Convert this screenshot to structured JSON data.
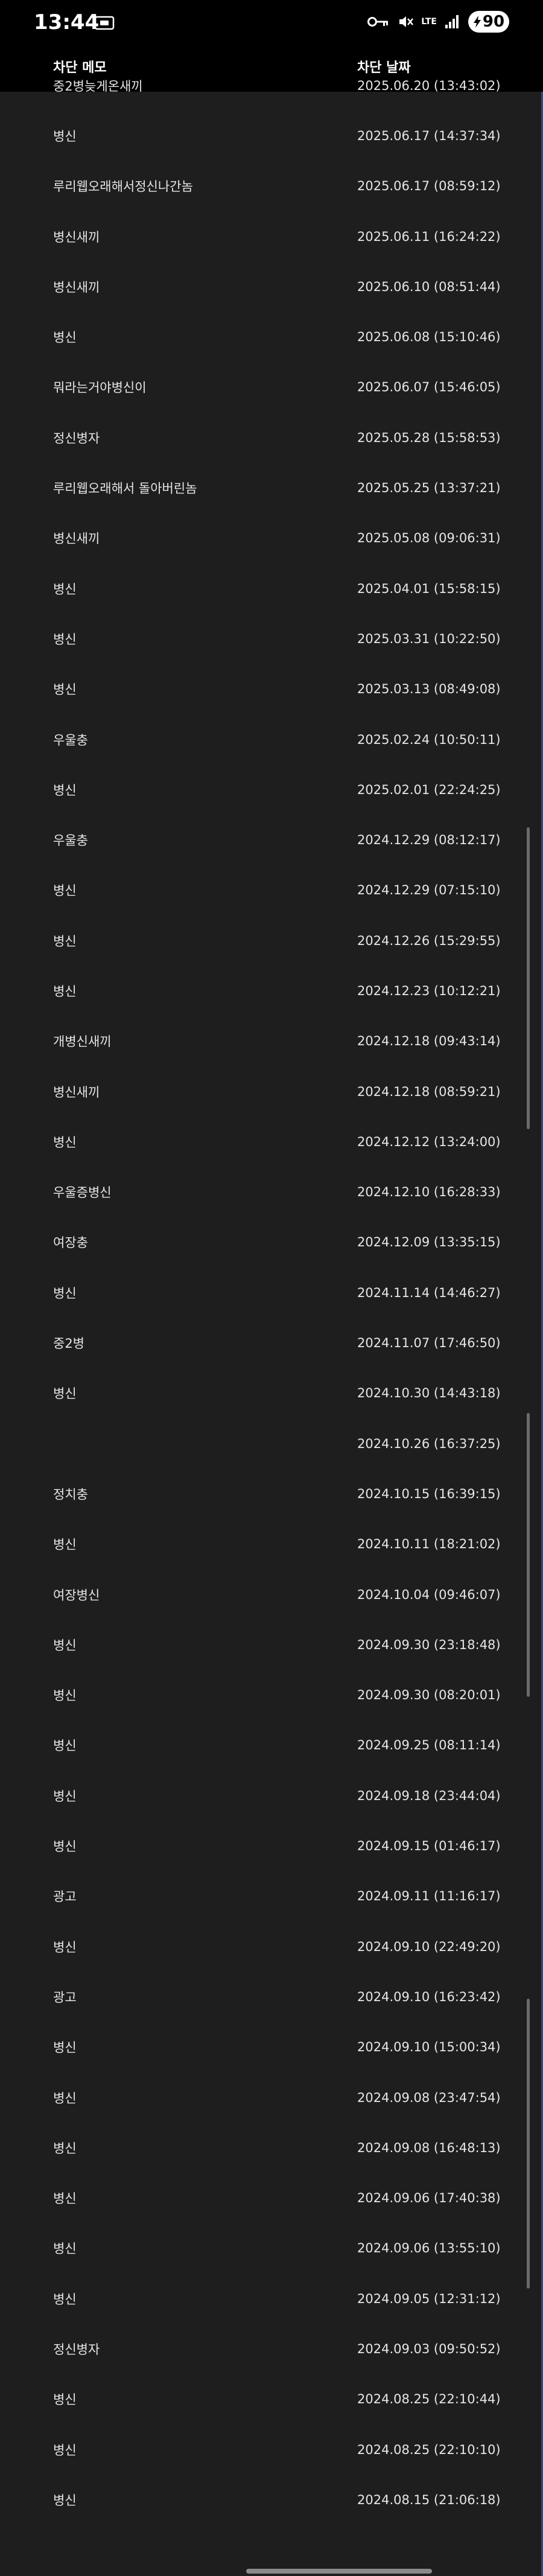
{
  "status_bar": {
    "time": "13:44",
    "network": "LTE",
    "battery": "90"
  },
  "header": {
    "memo_label": "차단 메모",
    "date_label": "차단 날짜"
  },
  "rows": [
    {
      "memo": "중2병늦게온새끼",
      "date": "2025.06.20 (13:43:02)"
    },
    {
      "memo": "병신",
      "date": "2025.06.17 (14:37:34)"
    },
    {
      "memo": "루리웹오래해서정신나간놈",
      "date": "2025.06.17 (08:59:12)"
    },
    {
      "memo": "병신새끼",
      "date": "2025.06.11 (16:24:22)"
    },
    {
      "memo": "병신새끼",
      "date": "2025.06.10 (08:51:44)"
    },
    {
      "memo": "병신",
      "date": "2025.06.08 (15:10:46)"
    },
    {
      "memo": "뭐라는거야병신이",
      "date": "2025.06.07 (15:46:05)"
    },
    {
      "memo": "정신병자",
      "date": "2025.05.28 (15:58:53)"
    },
    {
      "memo": "루리웹오래해서 돌아버린놈",
      "date": "2025.05.25 (13:37:21)"
    },
    {
      "memo": "병신새끼",
      "date": "2025.05.08 (09:06:31)"
    },
    {
      "memo": "병신",
      "date": "2025.04.01 (15:58:15)"
    },
    {
      "memo": "병신",
      "date": "2025.03.31 (10:22:50)"
    },
    {
      "memo": "병신",
      "date": "2025.03.13 (08:49:08)"
    },
    {
      "memo": "우울충",
      "date": "2025.02.24 (10:50:11)"
    },
    {
      "memo": "병신",
      "date": "2025.02.01 (22:24:25)"
    },
    {
      "memo": "우울충",
      "date": "2024.12.29 (08:12:17)"
    },
    {
      "memo": "병신",
      "date": "2024.12.29 (07:15:10)"
    },
    {
      "memo": "병신",
      "date": "2024.12.26 (15:29:55)"
    },
    {
      "memo": "병신",
      "date": "2024.12.23 (10:12:21)"
    },
    {
      "memo": "개병신새끼",
      "date": "2024.12.18 (09:43:14)"
    },
    {
      "memo": "병신새끼",
      "date": "2024.12.18 (08:59:21)"
    },
    {
      "memo": "병신",
      "date": "2024.12.12 (13:24:00)"
    },
    {
      "memo": "우울증병신",
      "date": "2024.12.10 (16:28:33)"
    },
    {
      "memo": "여장충",
      "date": "2024.12.09 (13:35:15)"
    },
    {
      "memo": "병신",
      "date": "2024.11.14 (14:46:27)"
    },
    {
      "memo": "중2병",
      "date": "2024.11.07 (17:46:50)"
    },
    {
      "memo": "병신",
      "date": "2024.10.30 (14:43:18)"
    },
    {
      "memo": "",
      "date": "2024.10.26 (16:37:25)"
    },
    {
      "memo": "정치충",
      "date": "2024.10.15 (16:39:15)"
    },
    {
      "memo": "병신",
      "date": "2024.10.11 (18:21:02)"
    },
    {
      "memo": "여장병신",
      "date": "2024.10.04 (09:46:07)"
    },
    {
      "memo": "병신",
      "date": "2024.09.30 (23:18:48)"
    },
    {
      "memo": "병신",
      "date": "2024.09.30 (08:20:01)"
    },
    {
      "memo": "병신",
      "date": "2024.09.25 (08:11:14)"
    },
    {
      "memo": "병신",
      "date": "2024.09.18 (23:44:04)"
    },
    {
      "memo": "병신",
      "date": "2024.09.15 (01:46:17)"
    },
    {
      "memo": "광고",
      "date": "2024.09.11 (11:16:17)"
    },
    {
      "memo": "병신",
      "date": "2024.09.10 (22:49:20)"
    },
    {
      "memo": "광고",
      "date": "2024.09.10 (16:23:42)"
    },
    {
      "memo": "병신",
      "date": "2024.09.10 (15:00:34)"
    },
    {
      "memo": "병신",
      "date": "2024.09.08 (23:47:54)"
    },
    {
      "memo": "병신",
      "date": "2024.09.08 (16:48:13)"
    },
    {
      "memo": "병신",
      "date": "2024.09.06 (17:40:38)"
    },
    {
      "memo": "병신",
      "date": "2024.09.06 (13:55:10)"
    },
    {
      "memo": "병신",
      "date": "2024.09.05 (12:31:12)"
    },
    {
      "memo": "정신병자",
      "date": "2024.09.03 (09:50:52)"
    },
    {
      "memo": "병신",
      "date": "2024.08.25 (22:10:44)"
    },
    {
      "memo": "병신",
      "date": "2024.08.25 (22:10:10)"
    },
    {
      "memo": "병신",
      "date": "2024.08.15 (21:06:18)"
    }
  ],
  "colors": {
    "background": "#1e1e1e",
    "status_bar": "#000000",
    "text": "#e6e6e6"
  },
  "icons": [
    "screen-record-icon",
    "key-icon",
    "mute-icon",
    "signal-icon",
    "charging-bolt-icon"
  ]
}
